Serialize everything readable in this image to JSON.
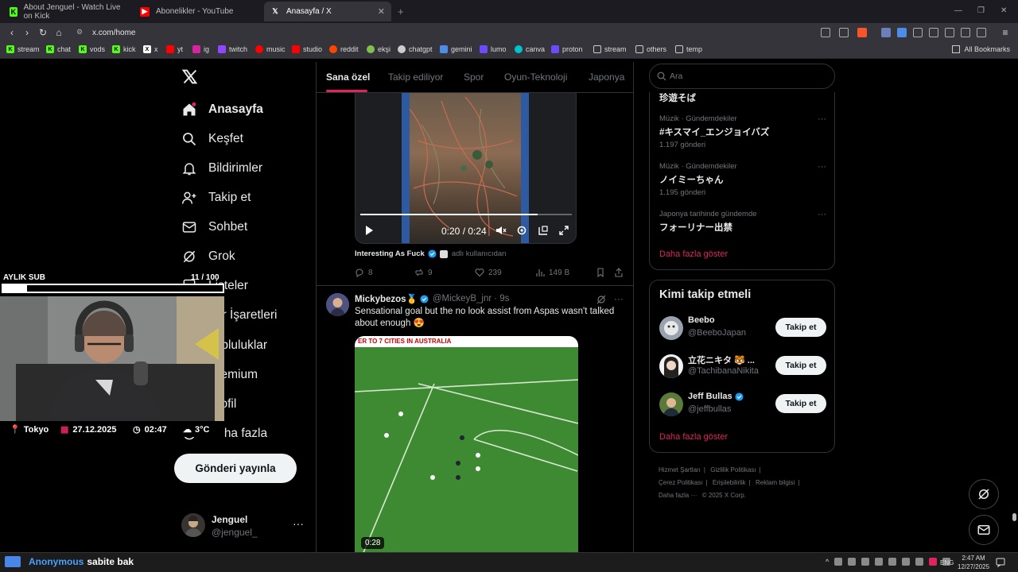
{
  "browser": {
    "tabs": [
      {
        "title": "About Jenguel - Watch Live on Kick",
        "icon": "kick-icon",
        "color": "#53fc18"
      },
      {
        "title": "Abonelikler - YouTube",
        "icon": "youtube-icon",
        "color": "#ff0000"
      },
      {
        "title": "Anasayfa / X",
        "icon": "x-icon",
        "color": "#ffffff"
      }
    ],
    "active_tab": 2,
    "url": "x.com/home",
    "bookmarks": [
      {
        "label": "stream",
        "icon": "kick-icon"
      },
      {
        "label": "chat",
        "icon": "kick-icon"
      },
      {
        "label": "vods",
        "icon": "kick-icon"
      },
      {
        "label": "kick",
        "icon": "kick-icon"
      },
      {
        "label": "x",
        "icon": "x-icon"
      },
      {
        "label": "yt",
        "icon": "youtube-icon"
      },
      {
        "label": "ig",
        "icon": "instagram-icon"
      },
      {
        "label": "twitch",
        "icon": "twitch-icon"
      },
      {
        "label": "music",
        "icon": "youtube-music-icon"
      },
      {
        "label": "studio",
        "icon": "youtube-studio-icon"
      },
      {
        "label": "reddit",
        "icon": "reddit-icon"
      },
      {
        "label": "ekşi",
        "icon": "eksi-icon"
      },
      {
        "label": "chatgpt",
        "icon": "chatgpt-icon"
      },
      {
        "label": "gemini",
        "icon": "gemini-icon"
      },
      {
        "label": "lumo",
        "icon": "lumo-icon"
      },
      {
        "label": "canva",
        "icon": "canva-icon"
      },
      {
        "label": "proton",
        "icon": "proton-icon"
      },
      {
        "label": "stream",
        "icon": "folder-icon"
      },
      {
        "label": "others",
        "icon": "folder-icon"
      },
      {
        "label": "temp",
        "icon": "folder-icon"
      }
    ],
    "all_bookmarks": "All Bookmarks"
  },
  "sidebar": {
    "items": [
      {
        "label": "Anasayfa",
        "icon": "home-icon"
      },
      {
        "label": "Keşfet",
        "icon": "search-icon"
      },
      {
        "label": "Bildirimler",
        "icon": "bell-icon"
      },
      {
        "label": "Takip et",
        "icon": "add-user-icon"
      },
      {
        "label": "Sohbet",
        "icon": "envelope-icon"
      },
      {
        "label": "Grok",
        "icon": "grok-icon"
      },
      {
        "label": "Listeler",
        "icon": "list-icon"
      },
      {
        "label": "Yer İşaretleri",
        "icon": "bookmark-icon"
      },
      {
        "label": "Topluluklar",
        "icon": "communities-icon"
      },
      {
        "label": "Premium",
        "icon": "premium-icon"
      },
      {
        "label": "Profil",
        "icon": "profile-icon"
      },
      {
        "label": "Daha fazla",
        "icon": "more-circle-icon"
      }
    ],
    "post_button": "Gönderi yayınla",
    "account": {
      "name": "Jenguel",
      "handle": "@jenguel_",
      "more": "···"
    }
  },
  "feed": {
    "tabs": [
      "Sana özel",
      "Takip ediliyor",
      "Spor",
      "Oyun-Teknoloji",
      "Japonya"
    ],
    "tweet1": {
      "video_time": "0:20 / 0:24",
      "video_progress": 0.84,
      "source_name": "Interesting As Fuck",
      "source_suffix": "adlı kullanıcıdan",
      "replies": "8",
      "retweets": "9",
      "likes": "239",
      "views": "149 B"
    },
    "tweet2": {
      "display_name": "Mickybezos🥇",
      "handle": "@MickeyB_jnr",
      "time": "· 9s",
      "text": "Sensational goal but the no look assist from Aspas wasn't talked about enough 😍",
      "video_banner": "ER TO 7 CITIES IN AUSTRALIA",
      "duration": "0:28"
    }
  },
  "right": {
    "search_placeholder": "Ara",
    "trends": [
      {
        "category": "",
        "name": "珍遊そば",
        "count": ""
      },
      {
        "category": "Müzik · Gündemdekiler",
        "name": "#キスマイ_エンジョイバズ",
        "count": "1.197 gönderi"
      },
      {
        "category": "Müzik · Gündemdekiler",
        "name": "ノイミーちゃん",
        "count": "1.195 gönderi"
      },
      {
        "category": "Japonya tarihinde gündemde",
        "name": "フォーリナー出禁",
        "count": ""
      }
    ],
    "trends_more": "Daha fazla göster",
    "who_to_follow": {
      "title": "Kimi takip etmeli",
      "users": [
        {
          "name": "Beebo",
          "handle": "@BeeboJapan",
          "button": "Takip et"
        },
        {
          "name": "立花ニキタ 🐯 ...",
          "handle": "@TachibanaNikita",
          "button": "Takip et"
        },
        {
          "name": "Jeff Bullas",
          "handle": "@jeffbullas",
          "button": "Takip et"
        }
      ],
      "more": "Daha fazla göster"
    },
    "footer": [
      "Hizmet Şartları",
      "|",
      "Gizlilik Politikası",
      "|",
      "Çerez Politikası",
      "|",
      "Erişilebilirlik",
      "|",
      "Reklam bilgisi",
      "|",
      "Daha fazla ···",
      "© 2025 X Corp."
    ]
  },
  "stream_overlay": {
    "sub_label": "AYLIK SUB",
    "sub_count": "11 / 100",
    "sub_progress": 0.11,
    "location": "Tokyo",
    "date": "27.12.2025",
    "time": "02:47",
    "temp": "3°C",
    "chat_user": "Anonymous",
    "chat_message": "sabite bak"
  },
  "taskbar": {
    "lang": "ENG",
    "clock_time": "2:47 AM",
    "clock_date": "12/27/2025"
  }
}
